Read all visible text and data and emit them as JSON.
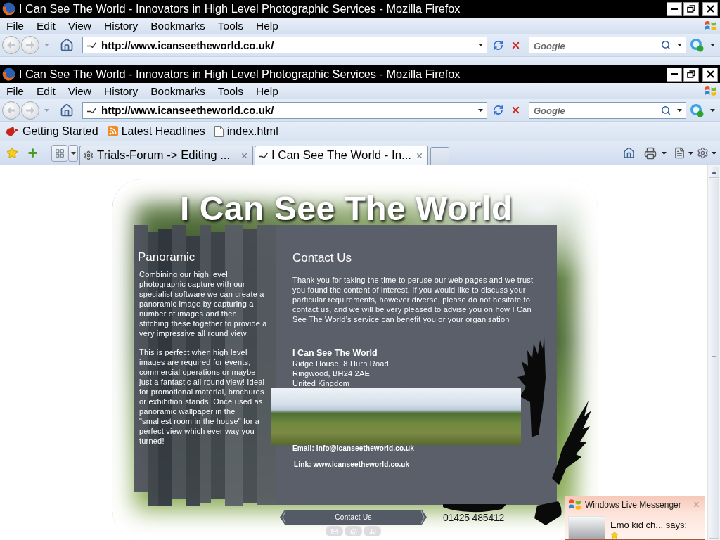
{
  "windows": [
    {
      "title": "I Can See The World - Innovators in High Level Photographic Services - Mozilla Firefox",
      "menu": [
        "File",
        "Edit",
        "View",
        "History",
        "Bookmarks",
        "Tools",
        "Help"
      ],
      "address": "http://www.icanseetheworld.co.uk/",
      "search": {
        "placeholder": "Google"
      }
    },
    {
      "title": "I Can See The World - Innovators in High Level Photographic Services - Mozilla Firefox",
      "menu": [
        "File",
        "Edit",
        "View",
        "History",
        "Bookmarks",
        "Tools",
        "Help"
      ],
      "address": "http://www.icanseetheworld.co.uk/",
      "search": {
        "placeholder": "Google"
      },
      "bookmarks": [
        {
          "kind": "starter",
          "label": "Getting Started"
        },
        {
          "kind": "feed",
          "label": "Latest Headlines"
        },
        {
          "kind": "page",
          "label": "index.html"
        }
      ],
      "tabs": [
        {
          "kind": "loading",
          "label": "Trials-Forum -> Editing ...",
          "selected": false
        },
        {
          "kind": "page",
          "label": "I Can See The World - In...",
          "selected": true
        }
      ],
      "page": {
        "site_title": "I Can See The World",
        "panoramic": {
          "heading": "Panoramic",
          "paragraphs": [
            "Combining our high level photographic capture with our specialist software we can create a panoramic image by capturing a number of images and then stitching these together to provide a very impressive all round view.",
            "This is perfect when high level images are required for events, commercial operations or maybe just a fantastic all round view! Ideal for promotional material, brochures or exhibition stands. Once used as panoramic wallpaper in the \"smallest room in the house\" for a perfect view which ever way you turned!"
          ]
        },
        "contact": {
          "heading": "Contact Us",
          "intro": "Thank you for taking the time to peruse our web pages and we trust you found the content of interest. If you would like to discuss your particular requirements, however diverse, please do not hesitate to contact us, and we will be very pleased to advise you on how I Can See The World’s service can benefit you or your organisation",
          "company": "I Can See The World",
          "address": [
            "Ridge House, 8 Hurn Road",
            "Ringwood, BH24 2AE",
            "United Kingdom"
          ],
          "email": "Email: info@icanseetheworld.co.uk",
          "link": "Link: www.icanseetheworld.co.uk"
        },
        "nav_button": "Contact Us",
        "phone": "01425 485412"
      }
    }
  ],
  "messenger": {
    "title": "Windows Live Messenger",
    "message": "Emo kid ch... says:"
  }
}
